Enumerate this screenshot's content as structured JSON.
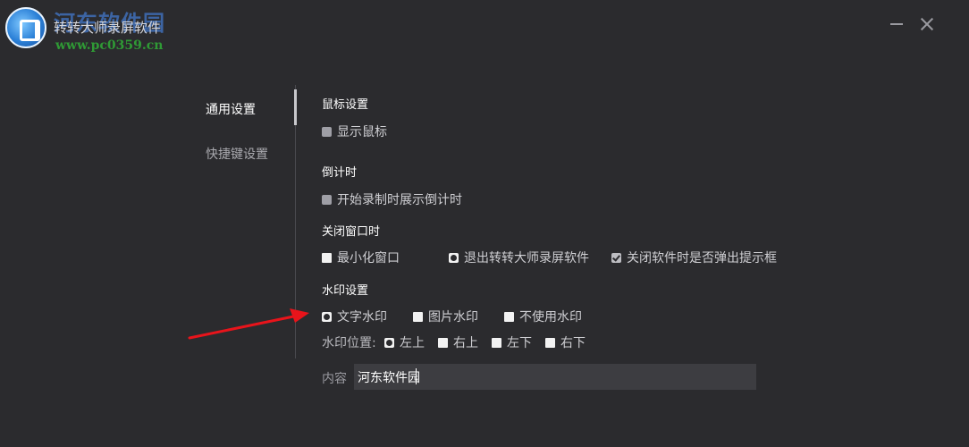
{
  "window": {
    "app_title": "转转大师录屏软件",
    "watermark_title": "河东软件园",
    "watermark_url": "www.pc0359.cn",
    "minimize_icon": "minimize-icon",
    "close_icon": "close-icon"
  },
  "sidebar": {
    "items": [
      {
        "label": "通用设置",
        "active": true
      },
      {
        "label": "快捷键设置",
        "active": false
      }
    ]
  },
  "settings": {
    "mouse": {
      "title": "鼠标设置",
      "show_cursor": {
        "label": "显示鼠标",
        "checked": false
      }
    },
    "countdown": {
      "title": "倒计时",
      "show_countdown": {
        "label": "开始录制时展示倒计时",
        "checked": false
      }
    },
    "close_window": {
      "title": "关闭窗口时",
      "options": [
        {
          "label": "最小化窗口",
          "selected": false
        },
        {
          "label": "退出转转大师录屏软件",
          "selected": true
        },
        {
          "label": "关闭软件时是否弹出提示框",
          "checked": true
        }
      ]
    },
    "watermark": {
      "title": "水印设置",
      "types": [
        {
          "label": "文字水印",
          "selected": true
        },
        {
          "label": "图片水印",
          "selected": false
        },
        {
          "label": "不使用水印",
          "selected": false
        }
      ],
      "position_label": "水印位置:",
      "positions": [
        {
          "label": "左上",
          "selected": true
        },
        {
          "label": "右上",
          "selected": false
        },
        {
          "label": "左下",
          "selected": false
        },
        {
          "label": "右下",
          "selected": false
        }
      ],
      "content_label": "内容",
      "content_value": "河东软件园"
    }
  },
  "colors": {
    "background": "#2b2b2e",
    "input_background": "#3d3d41",
    "arrow": "#e8141b",
    "watermark_url": "#2f9a35"
  }
}
